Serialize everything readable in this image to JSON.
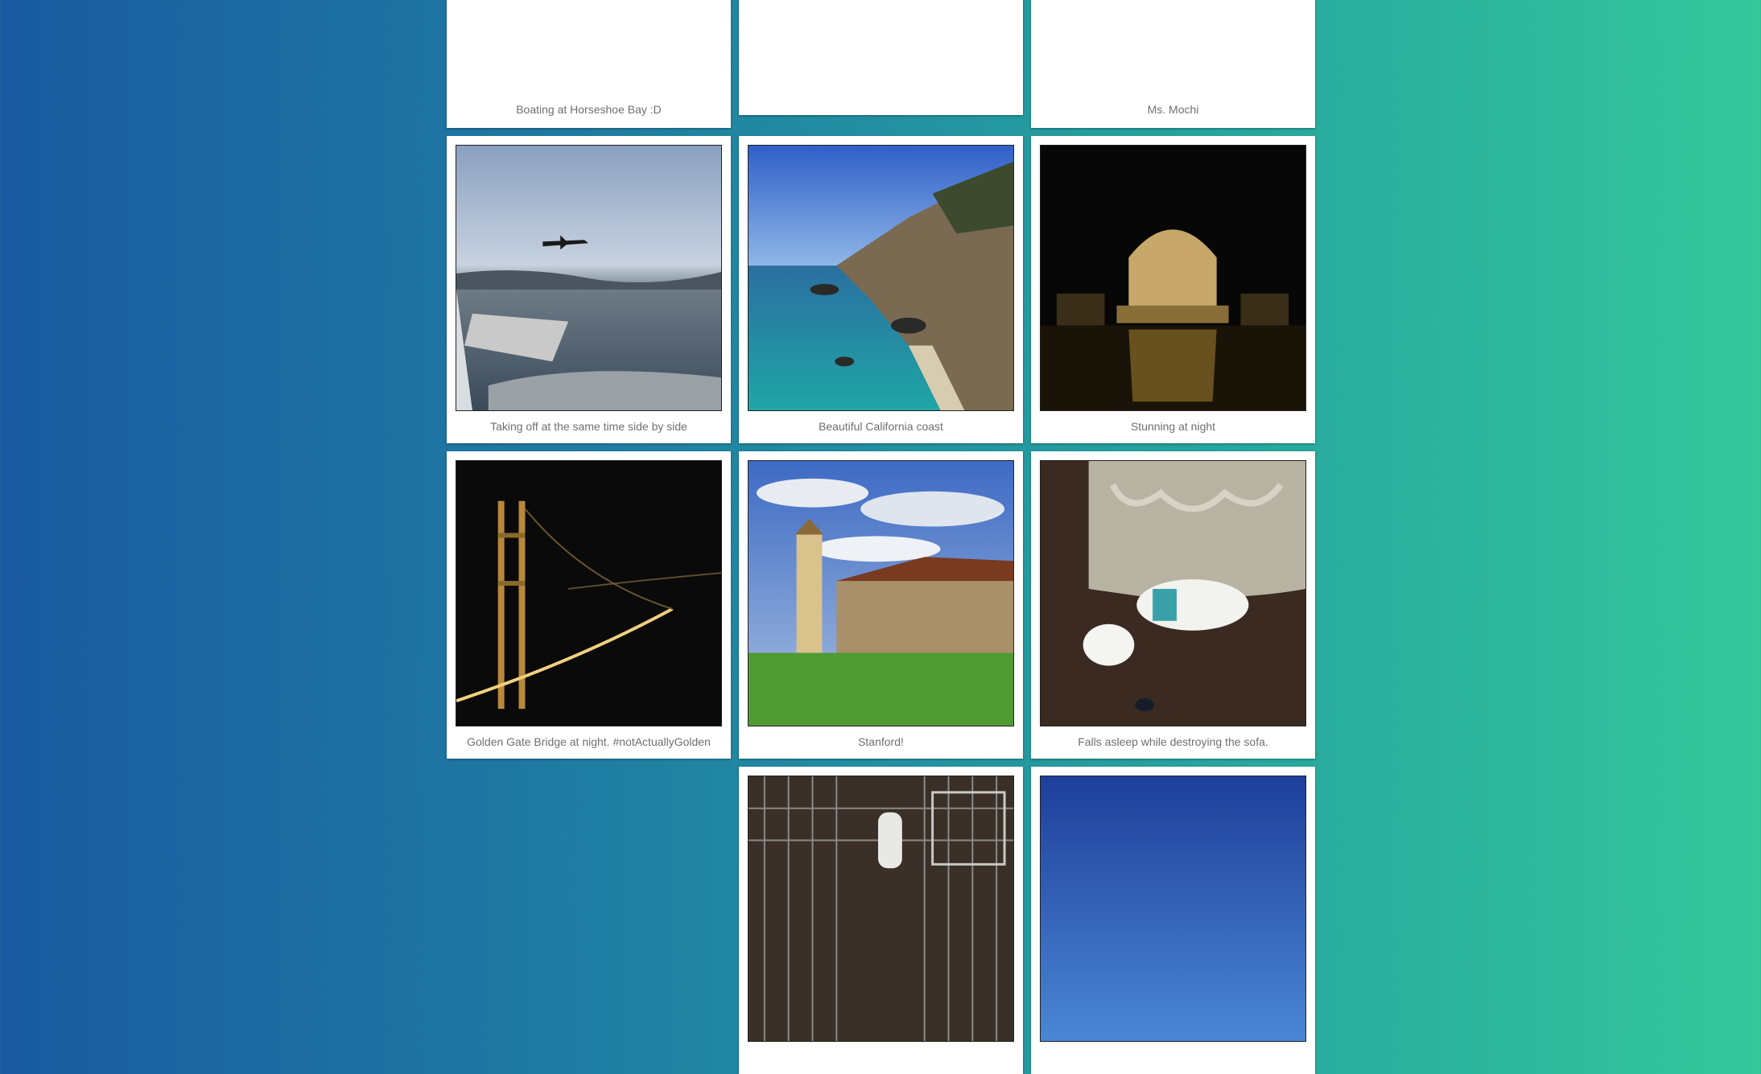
{
  "gallery": {
    "items": [
      {
        "caption": "Boating at Horseshoe Bay :D",
        "image": "boat-water-photo"
      },
      {
        "caption": "",
        "image": "rocks-shoreline-photo"
      },
      {
        "caption": "Ms. Mochi",
        "image": "dog-harness-photo"
      },
      {
        "caption": "Taking off at the same time side by side",
        "image": "airplane-window-photo"
      },
      {
        "caption": "Beautiful California coast",
        "image": "california-coast-photo"
      },
      {
        "caption": "Stunning at night",
        "image": "palace-night-photo"
      },
      {
        "caption": "Golden Gate Bridge at night. #notActuallyGolden",
        "image": "golden-gate-night-photo"
      },
      {
        "caption": "Stanford!",
        "image": "stanford-tower-photo"
      },
      {
        "caption": "Falls asleep while destroying the sofa.",
        "image": "dog-sleeping-sofa-photo"
      },
      {
        "caption": "",
        "image": "dog-crate-photo"
      },
      {
        "caption": "",
        "image": "blue-sky-photo"
      }
    ]
  }
}
